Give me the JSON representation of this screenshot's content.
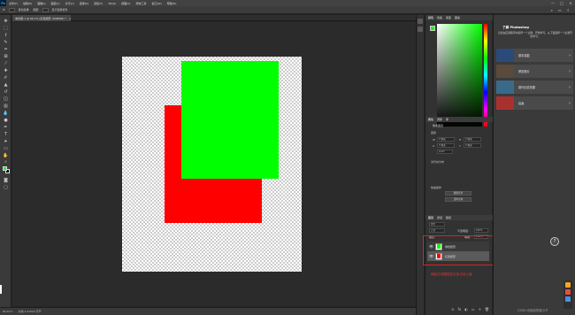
{
  "menubar": {
    "logo": "Ps",
    "items": [
      "文件(F)",
      "编辑(E)",
      "图像(I)",
      "图层(L)",
      "文字(Y)",
      "选择(S)",
      "滤镜(T)",
      "3D(D)",
      "视图(V)",
      "增效工具",
      "窗口(W)",
      "帮助(H)"
    ],
    "window_controls": [
      "—",
      "□",
      "✕"
    ]
  },
  "optbar": {
    "tool_icon": "move-icon",
    "auto_select_label": "自动选择:",
    "auto_select_value": "图层",
    "show_transform_label": "显示变换控件",
    "right_icons": [
      "⌕",
      "▭",
      "⇧"
    ]
  },
  "document": {
    "tab_label": "未标题-1 @ 66.7% (红色矩形, RGB/8#) *",
    "close_icon": "×"
  },
  "status": {
    "zoom": "66.67%",
    "size": "文档:1.91M/0 字节",
    "info": "文档大小"
  },
  "colors": {
    "foreground": "#00ff00",
    "background": "#000000",
    "red_layer": "#ff0000",
    "green_layer": "#00ff00",
    "annotation": "#ff3030"
  },
  "panels": {
    "color_tabs": [
      "颜色",
      "色板",
      "渐变",
      "图案"
    ],
    "properties_tabs": [
      "属性",
      "调整",
      "库"
    ],
    "properties": {
      "kind": "像素图层",
      "transform_title": "变换",
      "w_label": "W",
      "w_value": "0 像素",
      "h_label": "H",
      "h_value": "0 像素",
      "x_label": "X",
      "x_value": "0 像素",
      "y_label": "Y",
      "y_value": "0 像素",
      "angle": "0.00°",
      "align_title": "对齐并分布",
      "quick_title": "快速操作",
      "btn_remove_bg": "删除背景",
      "btn_select_subject": "选择主体"
    },
    "layers_tabs": [
      "图层",
      "通道",
      "路径"
    ],
    "layers_filter": "类型",
    "layers_mode": "正常",
    "opacity_label": "不透明度:",
    "opacity_value": "100%",
    "lock_label": "锁定:",
    "fill_label": "填充:",
    "fill_value": "100%",
    "layers": [
      {
        "name": "绿色矩形",
        "color": "#00ff00",
        "visible": "eye-icon"
      },
      {
        "name": "红色矩形",
        "color": "#ff0000",
        "visible": "eye-icon"
      }
    ],
    "layers_footer_icons": [
      "⊝",
      "fx",
      "◐",
      "▭",
      "+",
      "🗑"
    ]
  },
  "annotation_text": "绿色方块图层在红色方块上面",
  "learn": {
    "title": "了解 Photoshop",
    "description": "直接在应用程序中选择一个主题，开始学习，从下面选择一个主题开始学习。",
    "cards": [
      {
        "label": "基本技能",
        "thumb_color": "#2b4a7a"
      },
      {
        "label": "修复照片",
        "thumb_color": "#5a4a3a"
      },
      {
        "label": "制作创意效果",
        "thumb_color": "#3a6a8a"
      },
      {
        "label": "绘画",
        "thumb_color": "#aa3030"
      }
    ],
    "arrow": "›",
    "help_icon": "?"
  },
  "watermark": "CSDN @极品的猫爪子"
}
